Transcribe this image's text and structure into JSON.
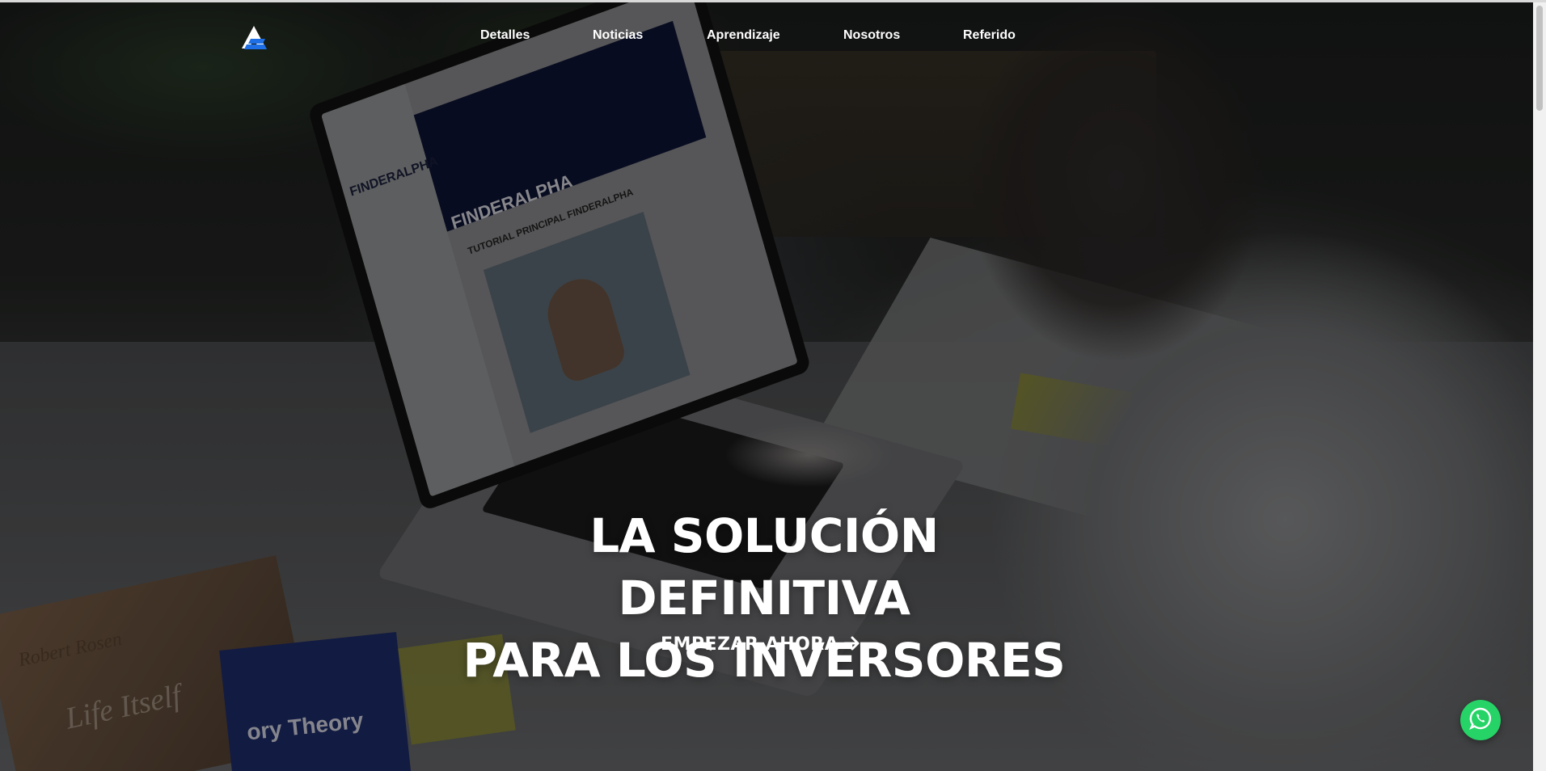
{
  "brand": {
    "logo_icon": "finderalpha-logo-icon"
  },
  "nav": {
    "items": [
      {
        "label": "Detalles"
      },
      {
        "label": "Noticias"
      },
      {
        "label": "Aprendizaje"
      },
      {
        "label": "Nosotros"
      },
      {
        "label": "Referido"
      }
    ]
  },
  "hero": {
    "title_line1": "LA SOLUCIÓN DEFINITIVA",
    "title_line2": "PARA LOS INVERSORES",
    "cta_label": "EMPEZAR AHORA",
    "cta_icon": "arrow-right-icon",
    "background_image_text": {
      "screen_brand": "FINDERALPHA",
      "screen_caption": "TUTORIAL PRINCIPAL FINDERALPHA",
      "book1_author": "Robert Rosen",
      "book1_title": "Life Itself",
      "book2_title": "ory Theory"
    }
  },
  "floating": {
    "whatsapp_icon": "whatsapp-icon"
  },
  "colors": {
    "accent_blue": "#1e6fe6",
    "whatsapp_green": "#25d366",
    "text": "#ffffff"
  }
}
